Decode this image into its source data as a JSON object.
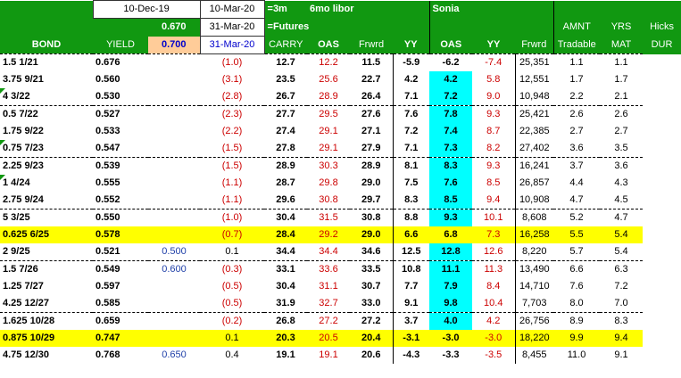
{
  "header": {
    "date1": "10-Dec-19",
    "date2": "10-Mar-20",
    "note1": "=3m",
    "note1b": "6mo libor",
    "sonia": "Sonia",
    "yield_top": "0.670",
    "date3": "31-Mar-20",
    "note2": "=Futures",
    "yield_peach": "0.700",
    "date4": "31-Mar-20",
    "cols": {
      "bond": "BOND",
      "yield": "YIELD",
      "carry": "CARRY",
      "oas": "OAS",
      "frwd": "Frwrd",
      "yy": "YY",
      "soas": "OAS",
      "syy": "YY",
      "sfrwd": "Frwrd",
      "amnt1": "AMNT",
      "amnt2": "Tradable",
      "yrs1": "YRS",
      "yrs2": "MAT",
      "hicks1": "Hicks",
      "hicks2": "DUR"
    }
  },
  "rows": [
    {
      "bond": "1.5  1/21",
      "yield": "0.676",
      "fut": "",
      "carry": "(1.0)",
      "oas": "12.7",
      "frwd": "12.2",
      "yy": "11.5",
      "soas": "-5.9",
      "syy": "-6.2",
      "sfrwd": "-7.4",
      "amnt": "25,351",
      "mat": "1.1",
      "dur": "1.1"
    },
    {
      "bond": "3.75  9/21",
      "yield": "0.560",
      "fut": "",
      "carry": "(3.1)",
      "oas": "23.5",
      "frwd": "25.6",
      "yy": "22.7",
      "soas": "4.2",
      "syy": "4.2",
      "sfrwd": "5.8",
      "amnt": "12,551",
      "mat": "1.7",
      "dur": "1.7"
    },
    {
      "bond": "4  3/22",
      "yield": "0.530",
      "fut": "",
      "carry": "(2.8)",
      "oas": "26.7",
      "frwd": "28.9",
      "yy": "26.4",
      "soas": "7.1",
      "syy": "7.2",
      "sfrwd": "9.0",
      "amnt": "10,948",
      "mat": "2.2",
      "dur": "2.1"
    },
    {
      "bond": "0.5  7/22",
      "yield": "0.527",
      "fut": "",
      "carry": "(2.3)",
      "oas": "27.7",
      "frwd": "29.5",
      "yy": "27.6",
      "soas": "7.6",
      "syy": "7.8",
      "sfrwd": "9.3",
      "amnt": "25,421",
      "mat": "2.6",
      "dur": "2.6"
    },
    {
      "bond": "1.75  9/22",
      "yield": "0.533",
      "fut": "",
      "carry": "(2.2)",
      "oas": "27.4",
      "frwd": "29.1",
      "yy": "27.1",
      "soas": "7.2",
      "syy": "7.4",
      "sfrwd": "8.7",
      "amnt": "22,385",
      "mat": "2.7",
      "dur": "2.7"
    },
    {
      "bond": "0.75  7/23",
      "yield": "0.547",
      "fut": "",
      "carry": "(1.5)",
      "oas": "27.8",
      "frwd": "29.1",
      "yy": "27.9",
      "soas": "7.1",
      "syy": "7.3",
      "sfrwd": "8.2",
      "amnt": "27,402",
      "mat": "3.6",
      "dur": "3.5"
    },
    {
      "bond": "2.25  9/23",
      "yield": "0.539",
      "fut": "",
      "carry": "(1.5)",
      "oas": "28.9",
      "frwd": "30.3",
      "yy": "28.9",
      "soas": "8.1",
      "syy": "8.3",
      "sfrwd": "9.3",
      "amnt": "16,241",
      "mat": "3.7",
      "dur": "3.6"
    },
    {
      "bond": "1  4/24",
      "yield": "0.555",
      "fut": "",
      "carry": "(1.1)",
      "oas": "28.7",
      "frwd": "29.8",
      "yy": "29.0",
      "soas": "7.5",
      "syy": "7.6",
      "sfrwd": "8.5",
      "amnt": "26,857",
      "mat": "4.4",
      "dur": "4.3"
    },
    {
      "bond": "2.75  9/24",
      "yield": "0.552",
      "fut": "",
      "carry": "(1.1)",
      "oas": "29.6",
      "frwd": "30.8",
      "yy": "29.7",
      "soas": "8.3",
      "syy": "8.5",
      "sfrwd": "9.4",
      "amnt": "10,908",
      "mat": "4.7",
      "dur": "4.5"
    },
    {
      "bond": "5  3/25",
      "yield": "0.550",
      "fut": "",
      "carry": "(1.0)",
      "oas": "30.4",
      "frwd": "31.5",
      "yy": "30.8",
      "soas": "8.8",
      "syy": "9.3",
      "sfrwd": "10.1",
      "amnt": "8,608",
      "mat": "5.2",
      "dur": "4.7"
    },
    {
      "bond": "0.625  6/25",
      "yield": "0.578",
      "fut": "",
      "carry": "(0.7)",
      "oas": "28.4",
      "frwd": "29.2",
      "yy": "29.0",
      "soas": "6.6",
      "syy": "6.8",
      "sfrwd": "7.3",
      "amnt": "16,258",
      "mat": "5.5",
      "dur": "5.4"
    },
    {
      "bond": "2  9/25",
      "yield": "0.521",
      "fut": "0.500",
      "carry": "0.1",
      "oas": "34.4",
      "frwd": "34.4",
      "yy": "34.6",
      "soas": "12.5",
      "syy": "12.8",
      "sfrwd": "12.6",
      "amnt": "8,220",
      "mat": "5.7",
      "dur": "5.4"
    },
    {
      "bond": "1.5  7/26",
      "yield": "0.549",
      "fut": "0.600",
      "carry": "(0.3)",
      "oas": "33.1",
      "frwd": "33.6",
      "yy": "33.5",
      "soas": "10.8",
      "syy": "11.1",
      "sfrwd": "11.3",
      "amnt": "13,490",
      "mat": "6.6",
      "dur": "6.3"
    },
    {
      "bond": "1.25  7/27",
      "yield": "0.597",
      "fut": "",
      "carry": "(0.5)",
      "oas": "30.4",
      "frwd": "31.1",
      "yy": "30.7",
      "soas": "7.7",
      "syy": "7.9",
      "sfrwd": "8.4",
      "amnt": "14,710",
      "mat": "7.6",
      "dur": "7.2"
    },
    {
      "bond": "4.25  12/27",
      "yield": "0.585",
      "fut": "",
      "carry": "(0.5)",
      "oas": "31.9",
      "frwd": "32.7",
      "yy": "33.0",
      "soas": "9.1",
      "syy": "9.8",
      "sfrwd": "10.4",
      "amnt": "7,703",
      "mat": "8.0",
      "dur": "7.0"
    },
    {
      "bond": "1.625  10/28",
      "yield": "0.659",
      "fut": "",
      "carry": "(0.2)",
      "oas": "26.8",
      "frwd": "27.2",
      "yy": "27.2",
      "soas": "3.7",
      "syy": "4.0",
      "sfrwd": "4.2",
      "amnt": "26,756",
      "mat": "8.9",
      "dur": "8.3"
    },
    {
      "bond": "0.875  10/29",
      "yield": "0.747",
      "fut": "",
      "carry": "0.1",
      "oas": "20.3",
      "frwd": "20.5",
      "yy": "20.4",
      "soas": "-3.1",
      "syy": "-3.0",
      "sfrwd": "-3.0",
      "amnt": "18,220",
      "mat": "9.9",
      "dur": "9.4"
    },
    {
      "bond": "4.75  12/30",
      "yield": "0.768",
      "fut": "0.650",
      "carry": "0.4",
      "oas": "19.1",
      "frwd": "19.1",
      "yy": "20.6",
      "soas": "-4.3",
      "syy": "-3.3",
      "sfrwd": "-3.5",
      "amnt": "8,455",
      "mat": "11.0",
      "dur": "9.1"
    }
  ],
  "colors": {
    "header_green": "#119811",
    "highlight_yellow": "#ffff00",
    "cyan": "#00ffff",
    "peach": "#ffcc99",
    "negative_red": "#cc0000",
    "futures_blue": "#1f3fa8"
  }
}
